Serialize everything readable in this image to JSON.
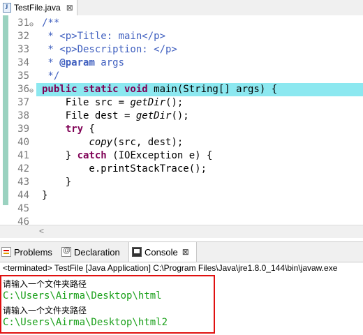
{
  "editor": {
    "tab_label": "TestFile.java",
    "tab_close": "⊠",
    "lines": [
      {
        "num": "31",
        "fold": "⊖",
        "html": "<span class='cmt'>/**</span>",
        "hl": false
      },
      {
        "num": "32",
        "fold": "",
        "html": "<span class='cmt'> * &lt;p&gt;Title: main&lt;/p&gt;</span>",
        "hl": false
      },
      {
        "num": "33",
        "fold": "",
        "html": "<span class='cmt'> * &lt;p&gt;Description: &lt;/p&gt;</span>",
        "hl": false
      },
      {
        "num": "34",
        "fold": "",
        "html": "<span class='cmt'> * <b>@param</b> args</span>",
        "hl": false
      },
      {
        "num": "35",
        "fold": "",
        "html": "<span class='cmt'> */</span>",
        "hl": false
      },
      {
        "num": "36",
        "fold": "⊖",
        "html": "<span class='kw'>public static void</span> main(String[] args) {",
        "hl": true
      },
      {
        "num": "37",
        "fold": "",
        "html": "    File src = <span class='it'>getDir</span>();",
        "hl": false
      },
      {
        "num": "38",
        "fold": "",
        "html": "    File dest = <span class='it'>getDir</span>();",
        "hl": false
      },
      {
        "num": "39",
        "fold": "",
        "html": "    <span class='kw'>try</span> {",
        "hl": false
      },
      {
        "num": "40",
        "fold": "",
        "html": "        <span class='it'>copy</span>(src, dest);",
        "hl": false
      },
      {
        "num": "41",
        "fold": "",
        "html": "    } <span class='kw'>catch</span> (IOException e) {",
        "hl": false
      },
      {
        "num": "42",
        "fold": "",
        "html": "        e.printStackTrace();",
        "hl": false
      },
      {
        "num": "43",
        "fold": "",
        "html": "    }",
        "hl": false
      },
      {
        "num": "44",
        "fold": "",
        "html": "}",
        "hl": false
      },
      {
        "num": "45",
        "fold": "",
        "html": "",
        "hl": false
      },
      {
        "num": "46",
        "fold": "",
        "html": "",
        "hl": false
      }
    ]
  },
  "views": {
    "problems_label": "Problems",
    "declaration_label": "Declaration",
    "console_label": "Console",
    "console_close": "⊠"
  },
  "console": {
    "status": "<terminated> TestFile [Java Application] C:\\Program Files\\Java\\jre1.8.0_144\\bin\\javaw.exe",
    "lines": [
      {
        "kind": "prompt",
        "text": "请输入一个文件夹路径"
      },
      {
        "kind": "input",
        "text": "C:\\Users\\Airma\\Desktop\\html"
      },
      {
        "kind": "prompt",
        "text": "请输入一个文件夹路径"
      },
      {
        "kind": "input",
        "text": "C:\\Users\\Airma\\Desktop\\html2"
      }
    ]
  },
  "colors": {
    "highlight_line": "#8ce8f0",
    "keyword": "#7f0055",
    "comment": "#3f5fbf",
    "console_input": "#1aa01a",
    "annotation_box": "#e01010"
  }
}
